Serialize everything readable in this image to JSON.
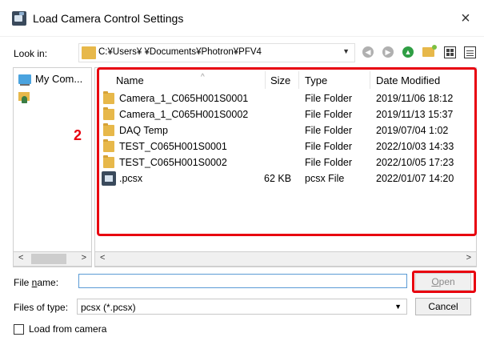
{
  "window": {
    "title": "Load Camera Control Settings",
    "close_glyph": "×",
    "icon": "pfv-camera-app-icon"
  },
  "toolbar": {
    "look_in_label": "Look in:",
    "path": "C:¥Users¥                  ¥Documents¥Photron¥PFV4",
    "path_dropdown_glyph": "▼",
    "buttons": [
      {
        "name": "back-icon",
        "glyph": "◀"
      },
      {
        "name": "forward-icon",
        "glyph": "▶"
      },
      {
        "name": "up-folder-icon",
        "glyph": "▲"
      },
      {
        "name": "new-folder-icon"
      },
      {
        "name": "grid-view-icon"
      },
      {
        "name": "details-view-icon"
      }
    ]
  },
  "nav": {
    "items": [
      {
        "label": "My Com...",
        "icon": "computer-icon"
      },
      {
        "label": "",
        "icon": "user-folder-icon"
      }
    ]
  },
  "file_list": {
    "columns": [
      "Name",
      "Size",
      "Type",
      "Date Modified"
    ],
    "rows": [
      {
        "name": "Camera_1_C065H001S0001",
        "size": "",
        "type": "File Folder",
        "date": "2019/11/06 18:12",
        "icon": "folder"
      },
      {
        "name": "Camera_1_C065H001S0002",
        "size": "",
        "type": "File Folder",
        "date": "2019/11/13 15:37",
        "icon": "folder"
      },
      {
        "name": "DAQ Temp",
        "size": "",
        "type": "File Folder",
        "date": "2019/07/04 1:02",
        "icon": "folder"
      },
      {
        "name": "TEST_C065H001S0001",
        "size": "",
        "type": "File Folder",
        "date": "2022/10/03 14:33",
        "icon": "folder"
      },
      {
        "name": "TEST_C065H001S0002",
        "size": "",
        "type": "File Folder",
        "date": "2022/10/05 17:23",
        "icon": "folder"
      },
      {
        "name": ".pcsx",
        "size": "62 KB",
        "type": "pcsx File",
        "date": "2022/01/07 14:20",
        "icon": "pcsx"
      }
    ]
  },
  "annotation": {
    "callout_number": "2",
    "highlight_color": "#e8000f"
  },
  "scroll": {
    "left_glyph": "<",
    "right_glyph": ">"
  },
  "file_name": {
    "label_pre": "File ",
    "label_u": "n",
    "label_post": "ame:",
    "value": ""
  },
  "open_button": {
    "label_u": "O",
    "label_post": "pen",
    "enabled": false
  },
  "file_type": {
    "label": "Files of type:",
    "selected": "pcsx (*.pcsx)",
    "dropdown_glyph": "▼"
  },
  "cancel_button": {
    "label": "Cancel"
  },
  "load_from_camera": {
    "label": "Load from camera",
    "checked": false
  },
  "colors": {
    "folder": "#e7b84a",
    "input_border": "#5b9bd5",
    "accent_red": "#e8000f"
  }
}
